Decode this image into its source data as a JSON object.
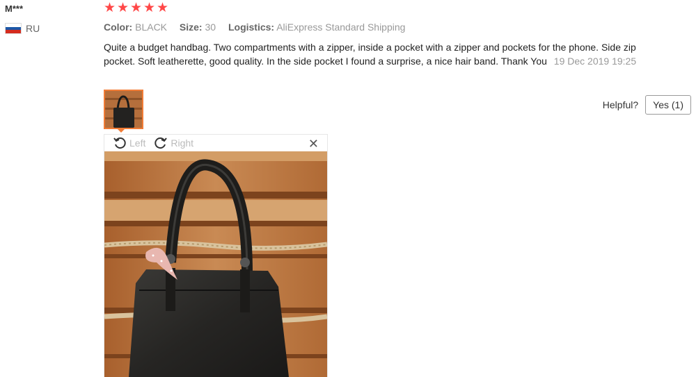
{
  "reviewer": {
    "name": "M***",
    "country": "RU"
  },
  "review": {
    "rating": 5,
    "attributes": [
      {
        "key": "Color:",
        "value": "BLACK"
      },
      {
        "key": "Size:",
        "value": "30"
      },
      {
        "key": "Logistics:",
        "value": "AliExpress Standard Shipping"
      }
    ],
    "text": "Quite a budget handbag. Two compartments with a zipper, inside a pocket with a zipper and pockets for the phone. Side zip pocket. Soft leatherette, good quality. In the side pocket I found a surprise, a nice hair band. Thank You",
    "date": "19 Dec 2019 19:25"
  },
  "helpful": {
    "label": "Helpful?",
    "yes_label": "Yes (1)"
  },
  "viewer": {
    "rotate_left": "Left",
    "rotate_right": "Right",
    "close_glyph": "✕"
  },
  "colors": {
    "star": "#ff4747",
    "thumb_border": "#f17c36"
  }
}
